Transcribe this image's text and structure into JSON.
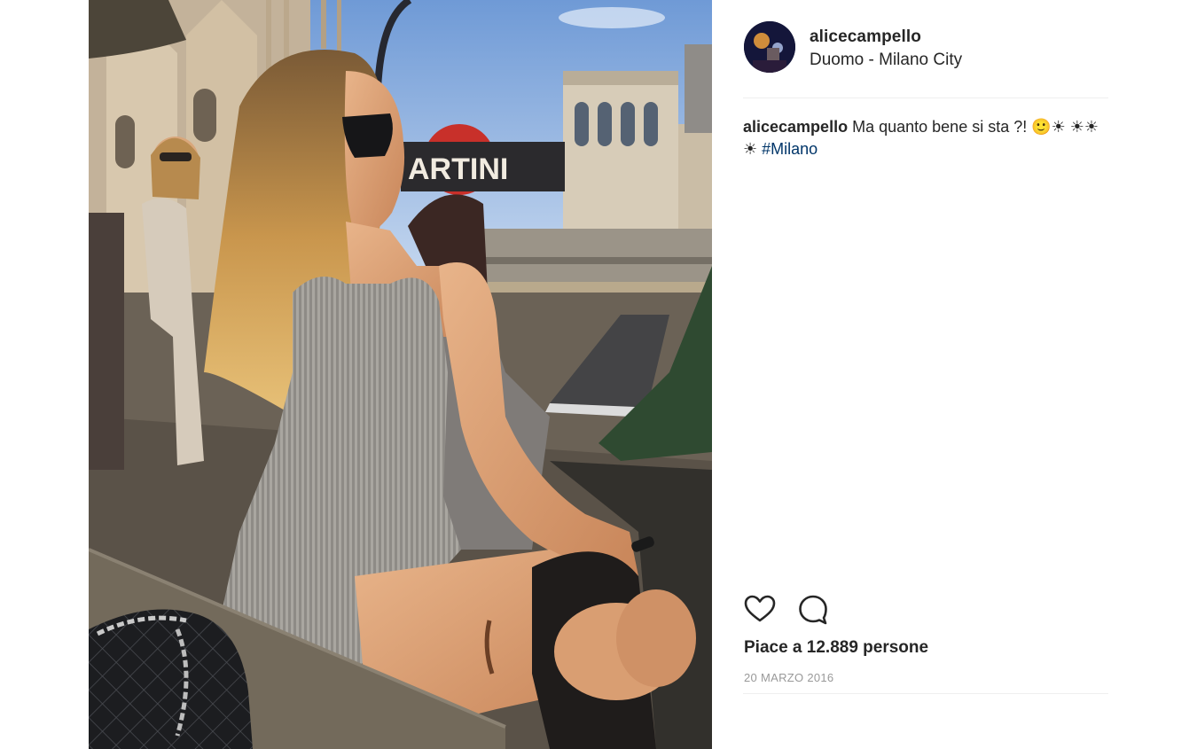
{
  "post": {
    "username": "alicecampello",
    "location": "Duomo - Milano City",
    "caption": {
      "user": "alicecampello",
      "text": "Ma quanto bene si sta ?! 🙂☀ ☀☀☀",
      "hashtag": "#Milano"
    },
    "likes_text": "Piace a 12.889 persone",
    "date": "20 MARZO 2016"
  },
  "photo": {
    "sign_text": "ARTINI"
  },
  "icons": {
    "like": "heart-icon",
    "comment": "comment-bubble-icon"
  },
  "colors": {
    "text": "#262626",
    "hashtag": "#003569",
    "muted": "#999999",
    "divider": "#efefef"
  }
}
